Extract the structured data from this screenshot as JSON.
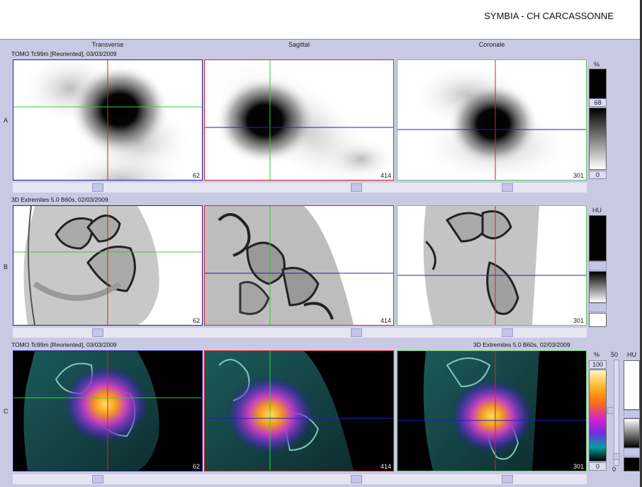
{
  "header": {
    "site_title": "SYMBIA - CH CARCASSONNE"
  },
  "columns": [
    "Transverse",
    "Sagittal",
    "Coronale"
  ],
  "rows": [
    {
      "label": "A",
      "series_left": "TOMO Tc99m [Reoriented], 03/03/2009",
      "series_right": "",
      "slices": [
        "62",
        "414",
        "301"
      ]
    },
    {
      "label": "B",
      "series_left": "3D  Extremites  5.0  B60s, 02/03/2009",
      "series_right": "",
      "slices": [
        "62",
        "414",
        "301"
      ]
    },
    {
      "label": "C",
      "series_left": "TOMO Tc99m [Reoriented], 03/03/2009",
      "series_right": "3D  Extremites  5.0  B60s, 02/03/2009",
      "slices": [
        "62",
        "414",
        "301"
      ]
    }
  ],
  "colorbars": {
    "a_unit": "%",
    "a_high": "68",
    "a_low": "0",
    "b_unit": "HU",
    "c_pct_unit": "%",
    "c_pct_high": "100",
    "c_pct_low": "0",
    "c_window": "50",
    "c_hu_unit": "HU",
    "c_hu_low": "0"
  },
  "colors": {
    "crosshair_red": "#e02020",
    "crosshair_green": "#30d030",
    "crosshair_blue": "#2020c0"
  }
}
